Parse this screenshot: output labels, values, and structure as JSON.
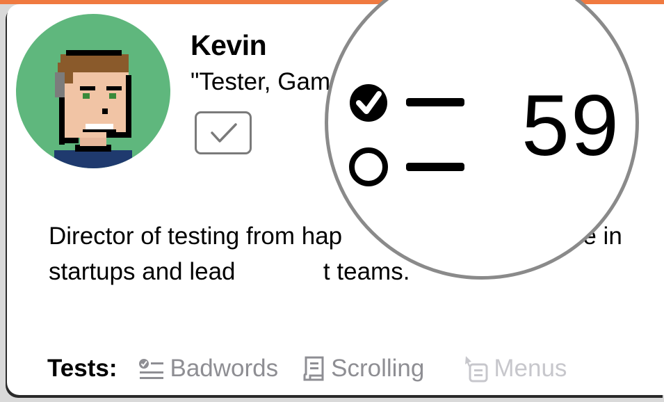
{
  "profile": {
    "name": "Kevin",
    "role": "\"Tester, Gam",
    "bio": "Director of testing from hap                    experience in startups and lead             t teams.",
    "avatar_bg": "#5fb77d",
    "checkbox_checked": true
  },
  "tests": {
    "label": "Tests:",
    "items": [
      {
        "label": "Badwords",
        "icon": "checklist-icon",
        "enabled": true
      },
      {
        "label": "Scrolling",
        "icon": "scroll-icon",
        "enabled": true
      },
      {
        "label": "Menus",
        "icon": "menu-pointer-icon",
        "enabled": false
      }
    ]
  },
  "magnifier": {
    "value": "59",
    "icon": "checklist-icon"
  },
  "colors": {
    "accent_bar": "#f07a40",
    "secondary_text": "#8e8e93",
    "disabled_text": "#c7c7cc"
  }
}
